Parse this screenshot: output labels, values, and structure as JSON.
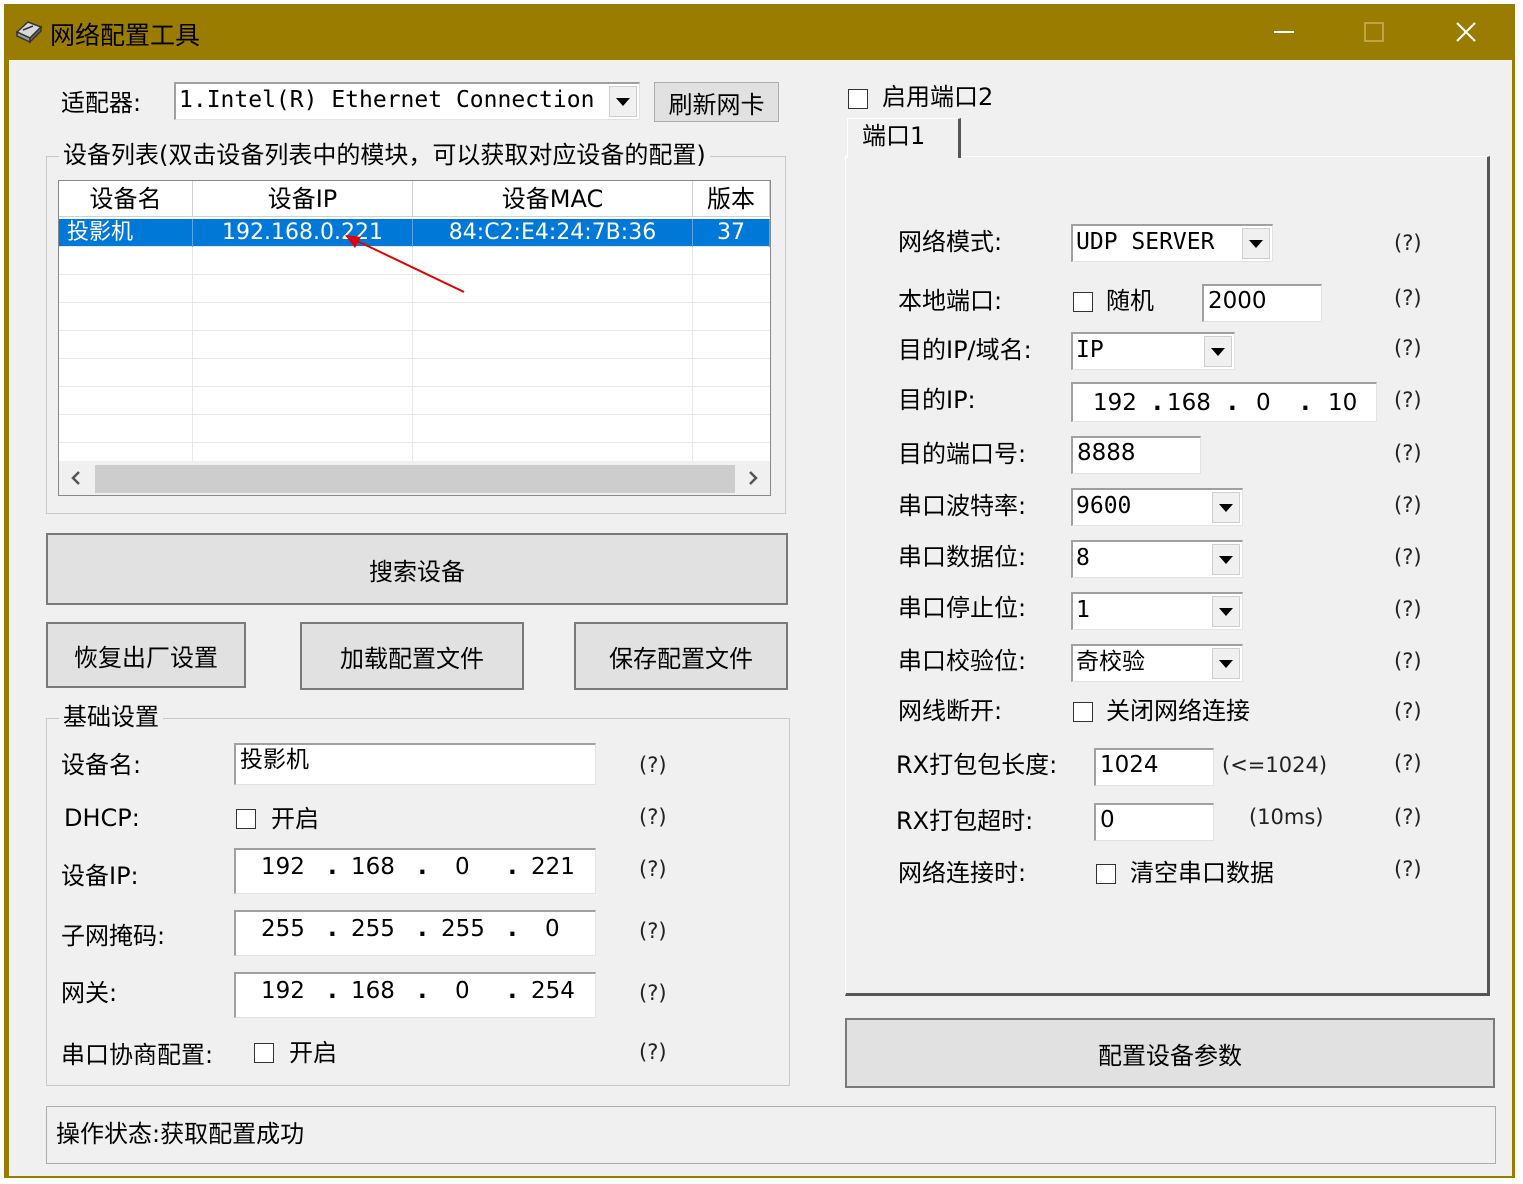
{
  "window": {
    "title": "网络配置工具",
    "title_bar_color": "#9a7d00"
  },
  "adapter": {
    "label": "适配器:",
    "selected": "1.Intel(R) Ethernet Connection",
    "refresh_button": "刷新网卡"
  },
  "device_list": {
    "group_title": "设备列表(双击设备列表中的模块，可以获取对应设备的配置)",
    "columns": [
      "设备名",
      "设备IP",
      "设备MAC",
      "版本"
    ],
    "rows": [
      {
        "name": "投影机",
        "ip": "192.168.0.221",
        "mac": "84:C2:E4:24:7B:36",
        "version": "37"
      }
    ],
    "selection_color": "#0078d7"
  },
  "buttons": {
    "search": "搜索设备",
    "factory_reset": "恢复出厂设置",
    "load_config": "加载配置文件",
    "save_config": "保存配置文件",
    "configure": "配置设备参数"
  },
  "basic": {
    "group_title": "基础设置",
    "help": "(?)",
    "device_name_label": "设备名:",
    "device_name_value": "投影机",
    "dhcp_label": "DHCP:",
    "dhcp_option": "开启",
    "device_ip_label": "设备IP:",
    "device_ip": [
      "192",
      "168",
      "0",
      "221"
    ],
    "subnet_label": "子网掩码:",
    "subnet": [
      "255",
      "255",
      "255",
      "0"
    ],
    "gateway_label": "网关:",
    "gateway": [
      "192",
      "168",
      "0",
      "254"
    ],
    "serial_negotiation_label": "串口协商配置:",
    "serial_negotiation_option": "开启"
  },
  "port2": {
    "label": "启用端口2"
  },
  "port_tab": {
    "tab_label": "端口1",
    "help": "(?)",
    "net_mode_label": "网络模式:",
    "net_mode_value": "UDP SERVER",
    "local_port_label": "本地端口:",
    "random_option": "随机",
    "local_port_value": "2000",
    "dest_type_label": "目的IP/域名:",
    "dest_type_value": "IP",
    "dest_ip_label": "目的IP:",
    "dest_ip": [
      "192",
      "168",
      "0",
      "10"
    ],
    "dest_port_label": "目的端口号:",
    "dest_port_value": "8888",
    "baud_label": "串口波特率:",
    "baud_value": "9600",
    "data_bits_label": "串口数据位:",
    "data_bits_value": "8",
    "stop_bits_label": "串口停止位:",
    "stop_bits_value": "1",
    "parity_label": "串口校验位:",
    "parity_value": "奇校验",
    "disconnect_label": "网线断开:",
    "disconnect_option": "关闭网络连接",
    "rx_len_label": "RX打包包长度:",
    "rx_len_value": "1024",
    "rx_len_hint": "(<=1024)",
    "rx_timeout_label": "RX打包超时:",
    "rx_timeout_value": "0",
    "rx_timeout_hint": "(10ms)",
    "on_connect_label": "网络连接时:",
    "on_connect_option": "清空串口数据"
  },
  "status": {
    "text": "操作状态:获取配置成功"
  }
}
